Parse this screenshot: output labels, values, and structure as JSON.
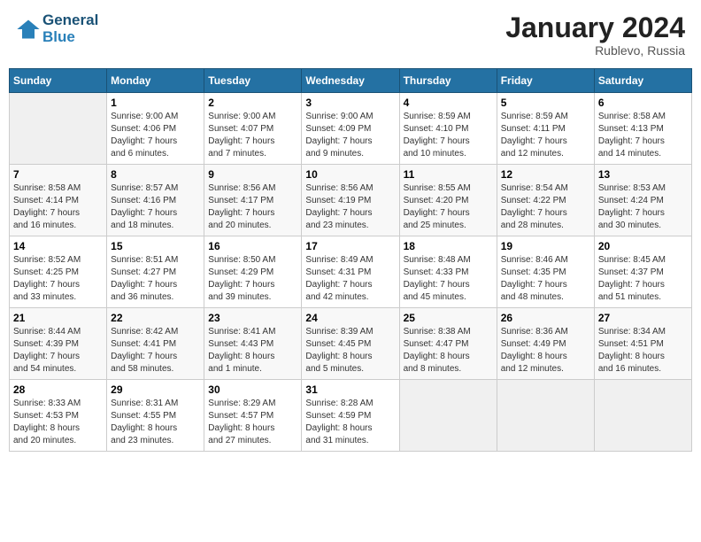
{
  "header": {
    "logo_line1": "General",
    "logo_line2": "Blue",
    "month": "January 2024",
    "location": "Rublevo, Russia"
  },
  "weekdays": [
    "Sunday",
    "Monday",
    "Tuesday",
    "Wednesday",
    "Thursday",
    "Friday",
    "Saturday"
  ],
  "weeks": [
    [
      {
        "day": "",
        "info": ""
      },
      {
        "day": "1",
        "info": "Sunrise: 9:00 AM\nSunset: 4:06 PM\nDaylight: 7 hours\nand 6 minutes."
      },
      {
        "day": "2",
        "info": "Sunrise: 9:00 AM\nSunset: 4:07 PM\nDaylight: 7 hours\nand 7 minutes."
      },
      {
        "day": "3",
        "info": "Sunrise: 9:00 AM\nSunset: 4:09 PM\nDaylight: 7 hours\nand 9 minutes."
      },
      {
        "day": "4",
        "info": "Sunrise: 8:59 AM\nSunset: 4:10 PM\nDaylight: 7 hours\nand 10 minutes."
      },
      {
        "day": "5",
        "info": "Sunrise: 8:59 AM\nSunset: 4:11 PM\nDaylight: 7 hours\nand 12 minutes."
      },
      {
        "day": "6",
        "info": "Sunrise: 8:58 AM\nSunset: 4:13 PM\nDaylight: 7 hours\nand 14 minutes."
      }
    ],
    [
      {
        "day": "7",
        "info": "Sunrise: 8:58 AM\nSunset: 4:14 PM\nDaylight: 7 hours\nand 16 minutes."
      },
      {
        "day": "8",
        "info": "Sunrise: 8:57 AM\nSunset: 4:16 PM\nDaylight: 7 hours\nand 18 minutes."
      },
      {
        "day": "9",
        "info": "Sunrise: 8:56 AM\nSunset: 4:17 PM\nDaylight: 7 hours\nand 20 minutes."
      },
      {
        "day": "10",
        "info": "Sunrise: 8:56 AM\nSunset: 4:19 PM\nDaylight: 7 hours\nand 23 minutes."
      },
      {
        "day": "11",
        "info": "Sunrise: 8:55 AM\nSunset: 4:20 PM\nDaylight: 7 hours\nand 25 minutes."
      },
      {
        "day": "12",
        "info": "Sunrise: 8:54 AM\nSunset: 4:22 PM\nDaylight: 7 hours\nand 28 minutes."
      },
      {
        "day": "13",
        "info": "Sunrise: 8:53 AM\nSunset: 4:24 PM\nDaylight: 7 hours\nand 30 minutes."
      }
    ],
    [
      {
        "day": "14",
        "info": "Sunrise: 8:52 AM\nSunset: 4:25 PM\nDaylight: 7 hours\nand 33 minutes."
      },
      {
        "day": "15",
        "info": "Sunrise: 8:51 AM\nSunset: 4:27 PM\nDaylight: 7 hours\nand 36 minutes."
      },
      {
        "day": "16",
        "info": "Sunrise: 8:50 AM\nSunset: 4:29 PM\nDaylight: 7 hours\nand 39 minutes."
      },
      {
        "day": "17",
        "info": "Sunrise: 8:49 AM\nSunset: 4:31 PM\nDaylight: 7 hours\nand 42 minutes."
      },
      {
        "day": "18",
        "info": "Sunrise: 8:48 AM\nSunset: 4:33 PM\nDaylight: 7 hours\nand 45 minutes."
      },
      {
        "day": "19",
        "info": "Sunrise: 8:46 AM\nSunset: 4:35 PM\nDaylight: 7 hours\nand 48 minutes."
      },
      {
        "day": "20",
        "info": "Sunrise: 8:45 AM\nSunset: 4:37 PM\nDaylight: 7 hours\nand 51 minutes."
      }
    ],
    [
      {
        "day": "21",
        "info": "Sunrise: 8:44 AM\nSunset: 4:39 PM\nDaylight: 7 hours\nand 54 minutes."
      },
      {
        "day": "22",
        "info": "Sunrise: 8:42 AM\nSunset: 4:41 PM\nDaylight: 7 hours\nand 58 minutes."
      },
      {
        "day": "23",
        "info": "Sunrise: 8:41 AM\nSunset: 4:43 PM\nDaylight: 8 hours\nand 1 minute."
      },
      {
        "day": "24",
        "info": "Sunrise: 8:39 AM\nSunset: 4:45 PM\nDaylight: 8 hours\nand 5 minutes."
      },
      {
        "day": "25",
        "info": "Sunrise: 8:38 AM\nSunset: 4:47 PM\nDaylight: 8 hours\nand 8 minutes."
      },
      {
        "day": "26",
        "info": "Sunrise: 8:36 AM\nSunset: 4:49 PM\nDaylight: 8 hours\nand 12 minutes."
      },
      {
        "day": "27",
        "info": "Sunrise: 8:34 AM\nSunset: 4:51 PM\nDaylight: 8 hours\nand 16 minutes."
      }
    ],
    [
      {
        "day": "28",
        "info": "Sunrise: 8:33 AM\nSunset: 4:53 PM\nDaylight: 8 hours\nand 20 minutes."
      },
      {
        "day": "29",
        "info": "Sunrise: 8:31 AM\nSunset: 4:55 PM\nDaylight: 8 hours\nand 23 minutes."
      },
      {
        "day": "30",
        "info": "Sunrise: 8:29 AM\nSunset: 4:57 PM\nDaylight: 8 hours\nand 27 minutes."
      },
      {
        "day": "31",
        "info": "Sunrise: 8:28 AM\nSunset: 4:59 PM\nDaylight: 8 hours\nand 31 minutes."
      },
      {
        "day": "",
        "info": ""
      },
      {
        "day": "",
        "info": ""
      },
      {
        "day": "",
        "info": ""
      }
    ]
  ]
}
